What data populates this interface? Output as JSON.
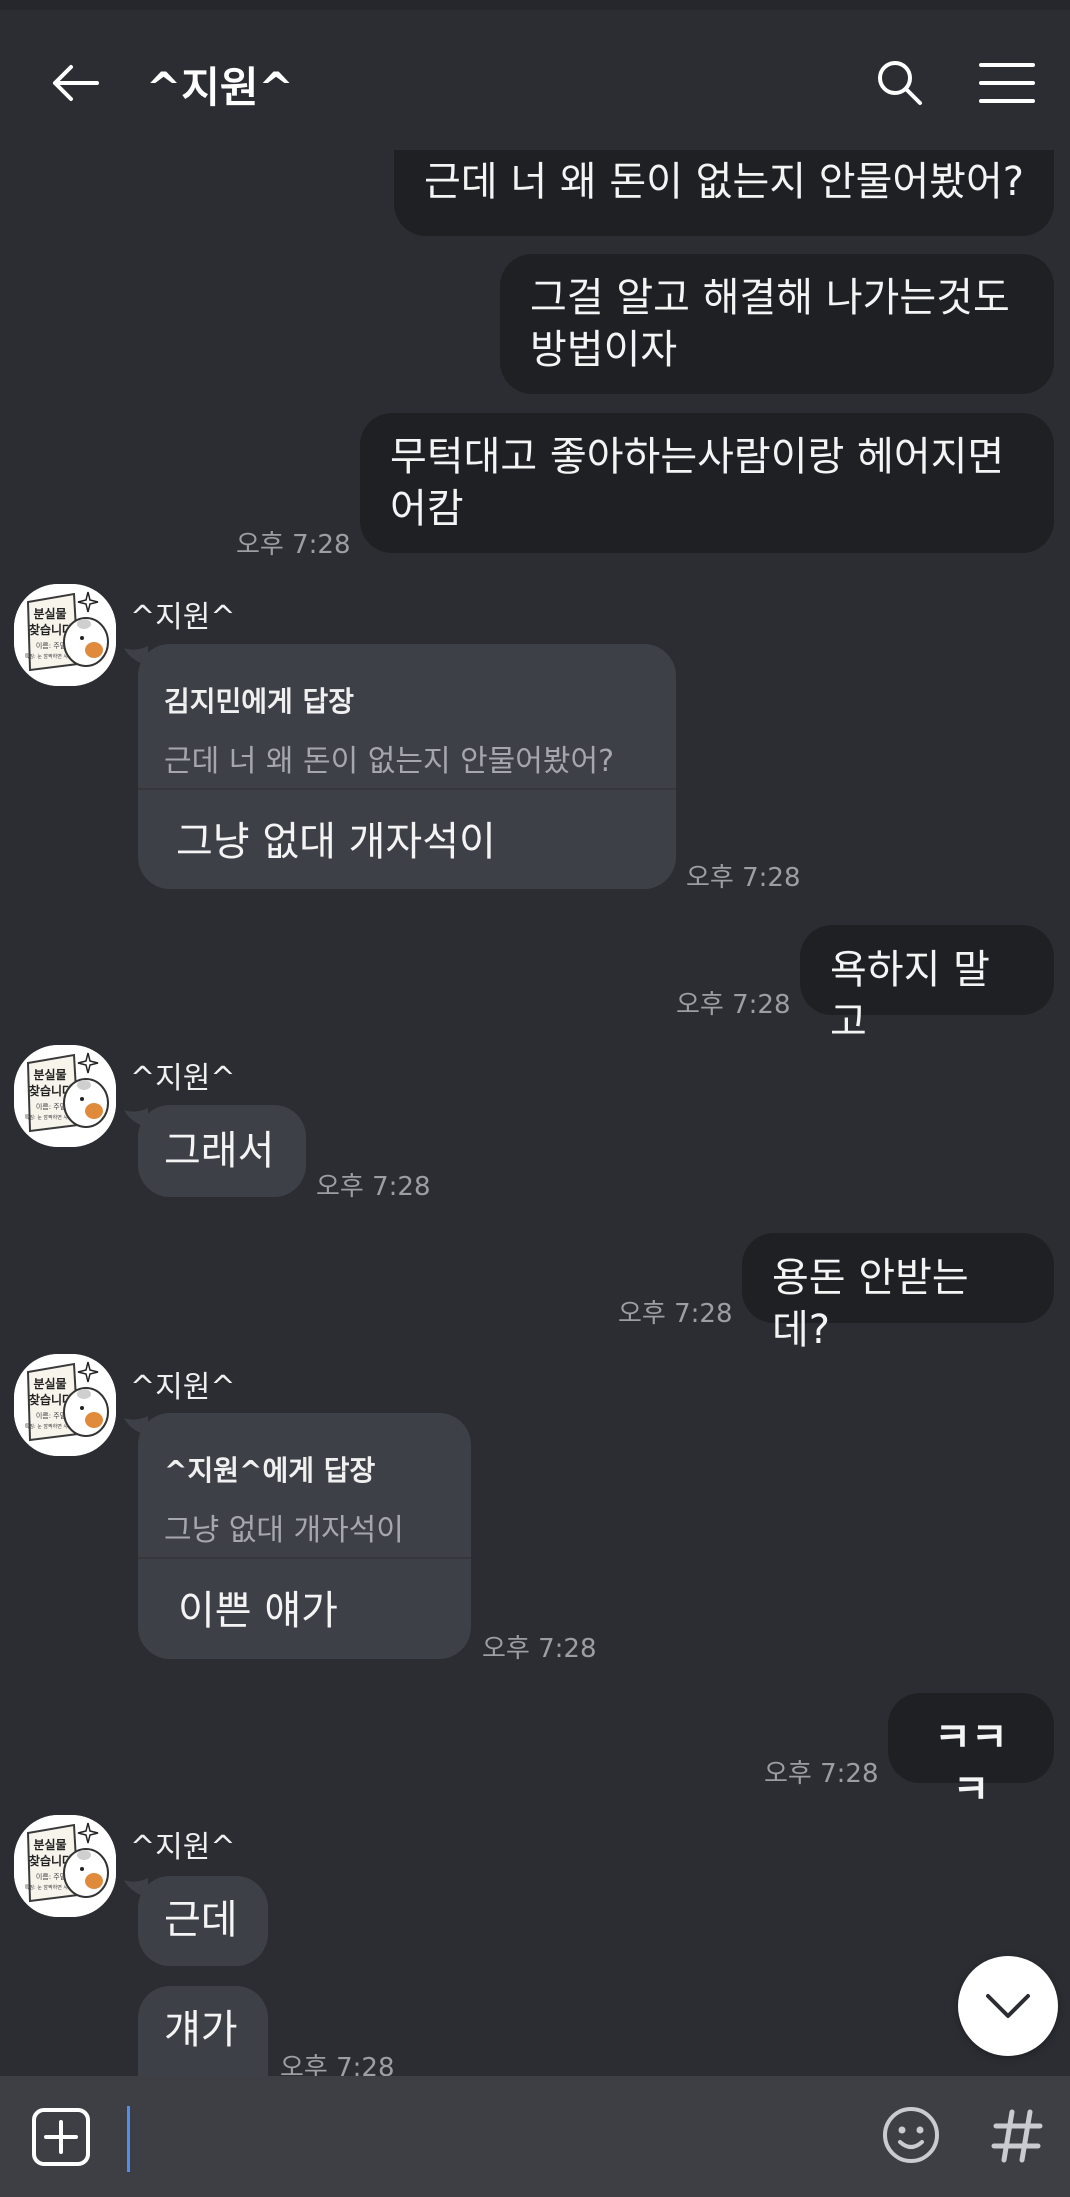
{
  "header": {
    "title": "^지원^"
  },
  "messages": {
    "m1": "근데 너 왜 돈이 없는지 안물어봤어?",
    "m2_line1": "그걸 알고 해결해 나가는것도",
    "m2_line2": "방법이자",
    "m3_line1": "무턱대고 좋아하는사람이랑 헤어지면",
    "m3_line2": "어캄",
    "m3_time": "오후 7:28",
    "r1_sender": "^지원^",
    "r1_reply_to": "김지민에게 답장",
    "r1_quote": "근데 너 왜 돈이 없는지 안물어봤어?",
    "r1_text": "그냥 없대 개자석이",
    "r1_time": "오후 7:28",
    "m4": "욕하지 말고",
    "m4_time": "오후 7:28",
    "r2_sender": "^지원^",
    "r2_text": "그래서",
    "r2_time": "오후 7:28",
    "m5": "용돈 안받는데?",
    "m5_time": "오후 7:28",
    "r3_sender": "^지원^",
    "r3_reply_to": "^지원^에게 답장",
    "r3_quote": "그냥 없대 개자석이",
    "r3_text": "이쁜 얘가",
    "r3_time": "오후 7:28",
    "m6": "ㅋㅋㅋ",
    "m6_time": "오후 7:28",
    "r4_sender": "^지원^",
    "r4_text1": "근데",
    "r4_text2": "걔가",
    "r4_time": "오후 7:28"
  },
  "avatar": {
    "line1": "분실물",
    "line2": "찾습니다",
    "line3": "이름: 주말",
    "line4": "특징: 눈 깜짝하면 사라짐"
  },
  "icons": {
    "back": "arrow-left-icon",
    "search": "search-icon",
    "menu": "hamburger-menu-icon",
    "attach": "plus-square-icon",
    "emoji": "emoji-icon",
    "hashtag": "hashtag-icon",
    "scroll": "chevron-down-icon"
  },
  "colors": {
    "background": "#2b2d33",
    "my_bubble": "#1f2024",
    "their_bubble": "#3e4047",
    "caret": "#4f8ef0"
  }
}
